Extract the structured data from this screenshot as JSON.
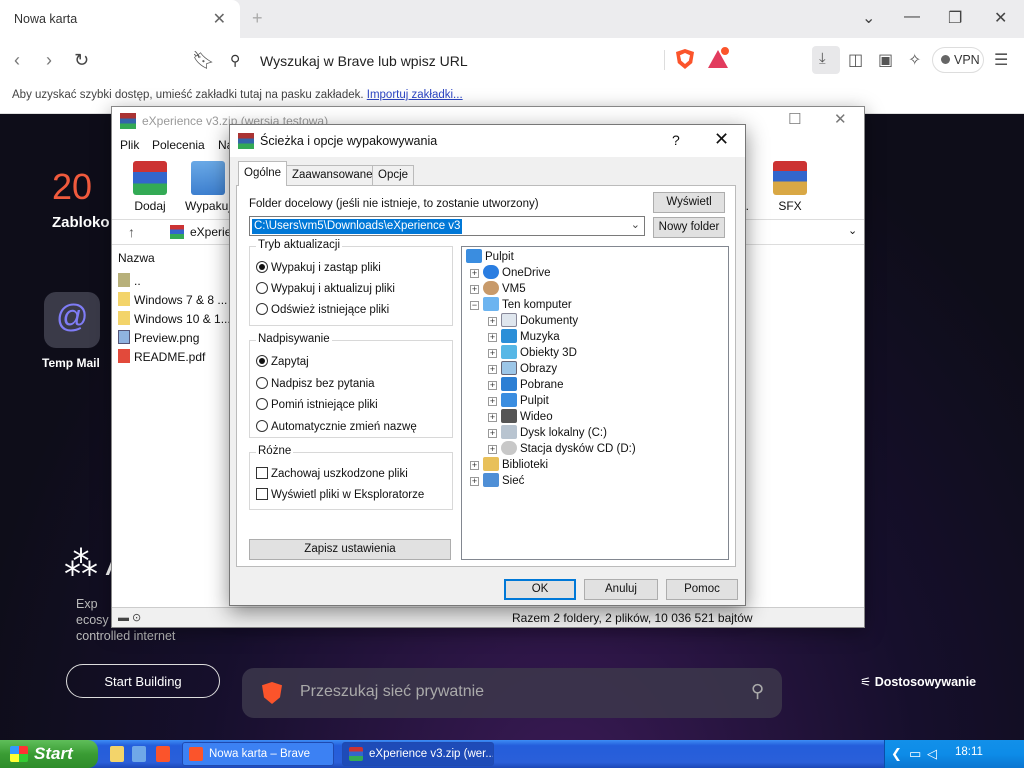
{
  "browser": {
    "tab_title": "Nowa karta",
    "url_placeholder": "Wyszukaj w Brave lub wpisz URL",
    "vpn_label": "VPN",
    "bookmarks_msg": "Aby uzyskać szybki dostęp, umieść zakładki tutaj na pasku zakładek.",
    "bookmarks_link": "Importuj zakładki..."
  },
  "newtab": {
    "stat_number": "20",
    "stat_label": "Zabloko",
    "shortcut_label": "Temp Mail",
    "brand_text_1": "Exp",
    "brand_text_2": "ecosy",
    "brand_text_3": "controlled internet",
    "start_building": "Start Building",
    "search_placeholder": "Przeszukaj sieć prywatnie",
    "customize": "Dostosowywanie"
  },
  "winrar": {
    "title": "eXperience v3.zip (wersja testowa)",
    "menu": [
      "Plik",
      "Polecenia",
      "Na"
    ],
    "toolbar": [
      "Dodaj",
      "Wypakuj",
      "z...",
      "SFX"
    ],
    "path_value": "eXperie",
    "column_name": "Nazwa",
    "files": [
      "..",
      "Windows 7 & 8 ...",
      "Windows 10 & 1...",
      "Preview.png",
      "README.pdf"
    ],
    "status": "Razem 2 foldery, 2 plików, 10 036 521 bajtów"
  },
  "dialog": {
    "title": "Ścieżka i opcje wypakowywania",
    "help": "?",
    "tabs": [
      "Ogólne",
      "Zaawansowane",
      "Opcje"
    ],
    "dest_label": "Folder docelowy (jeśli nie istnieje, to zostanie utworzony)",
    "dest_value": "C:\\Users\\vm5\\Downloads\\eXperience v3",
    "show_btn": "Wyświetl",
    "new_folder_btn": "Nowy folder",
    "update_mode": {
      "title": "Tryb aktualizacji",
      "options": [
        "Wypakuj i zastąp pliki",
        "Wypakuj i aktualizuj pliki",
        "Odśwież istniejące pliki"
      ],
      "selected": 0
    },
    "overwrite": {
      "title": "Nadpisywanie",
      "options": [
        "Zapytaj",
        "Nadpisz bez pytania",
        "Pomiń istniejące pliki",
        "Automatycznie zmień nazwę"
      ],
      "selected": 0
    },
    "misc": {
      "title": "Różne",
      "options": [
        "Zachowaj uszkodzone pliki",
        "Wyświetl pliki w Eksploratorze"
      ]
    },
    "save_btn": "Zapisz ustawienia",
    "tree": [
      "Pulpit",
      "OneDrive",
      "VM5",
      "Ten komputer",
      "Dokumenty",
      "Muzyka",
      "Obiekty 3D",
      "Obrazy",
      "Pobrane",
      "Pulpit",
      "Wideo",
      "Dysk lokalny (C:)",
      "Stacja dysków CD (D:)",
      "Biblioteki",
      "Sieć"
    ],
    "ok": "OK",
    "cancel": "Anuluj",
    "help_btn": "Pomoc"
  },
  "taskbar": {
    "start": "Start",
    "items": [
      "Nowa karta – Brave",
      "eXperience v3.zip (wer..."
    ],
    "clock": "18:11"
  },
  "colors": {
    "brave_orange": "#fb542b",
    "selection_blue": "#0078d7",
    "xp_blue": "#245edb"
  }
}
